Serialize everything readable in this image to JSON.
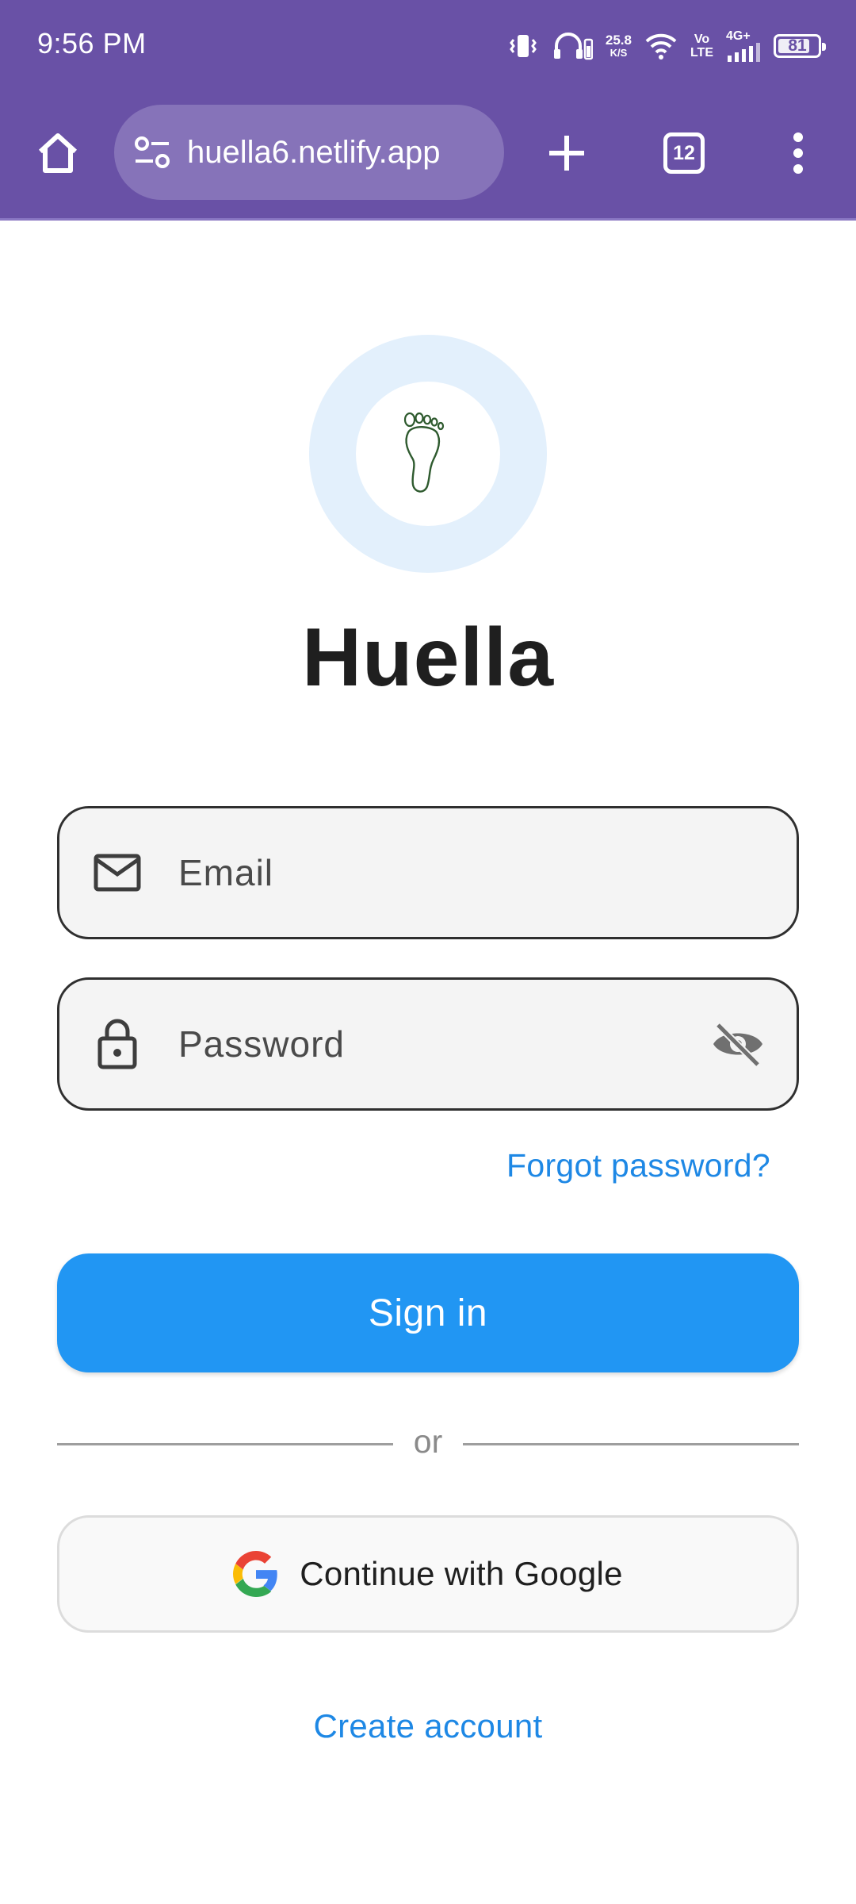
{
  "status_bar": {
    "time": "9:56 PM",
    "network_speed_value": "25.8",
    "network_speed_unit": "K/S",
    "volte_line1": "Vo",
    "volte_line2": "LTE",
    "network_type": "4G+",
    "battery_level": "81",
    "battery_fraction": 0.81
  },
  "browser": {
    "url": "huella6.netlify.app",
    "tab_count": "12",
    "icons": [
      "home-icon",
      "site-settings-icon",
      "plus-icon",
      "tabs-icon",
      "more-vert-icon"
    ]
  },
  "app": {
    "title": "Huella",
    "logo_icon": "footprint-icon",
    "colors": {
      "primary": "#2196f3",
      "link": "#1e88e5",
      "logo_ring": "#e3f0fc",
      "chrome": "#6951a6"
    }
  },
  "form": {
    "email_placeholder": "Email",
    "email_value": "",
    "password_placeholder": "Password",
    "password_value": "",
    "forgot_password": "Forgot password?",
    "sign_in": "Sign in",
    "divider": "or",
    "google": "Continue with Google",
    "create_account": "Create account"
  }
}
